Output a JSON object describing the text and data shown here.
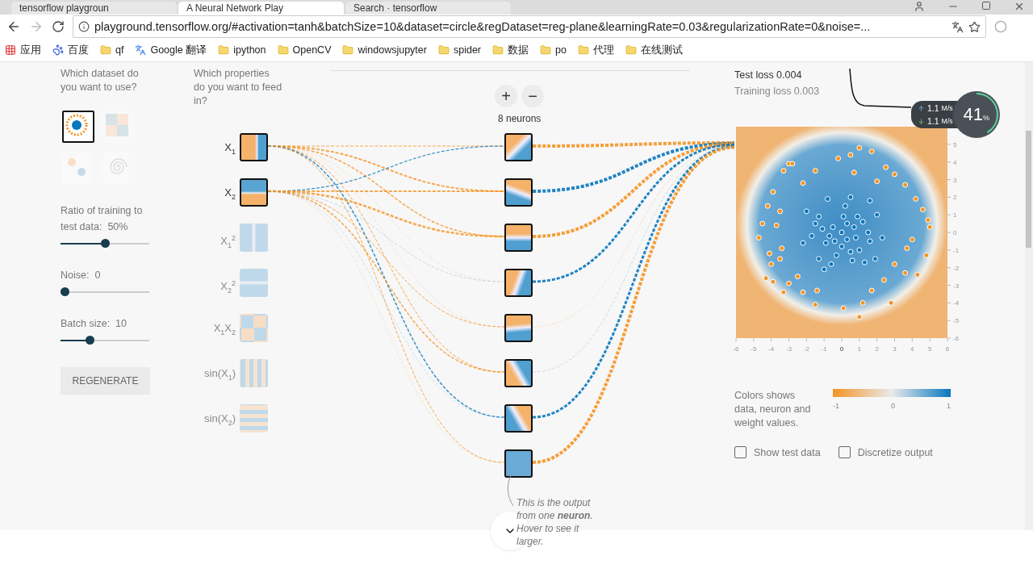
{
  "browser": {
    "tabs": [
      {
        "label": "tensorflow playgroun",
        "selected": false
      },
      {
        "label": "A Neural Network Play",
        "selected": true
      },
      {
        "label": "Search · tensorflow",
        "selected": false
      }
    ],
    "url": "playground.tensorflow.org/#activation=tanh&batchSize=10&dataset=circle&regDataset=reg-plane&learningRate=0.03&regularizationRate=0&noise=...",
    "bookmarks": [
      {
        "label": "应用",
        "kind": "apps"
      },
      {
        "label": "百度",
        "kind": "paw"
      },
      {
        "label": "qf",
        "kind": "folder"
      },
      {
        "label": "Google 翻译",
        "kind": "translate"
      },
      {
        "label": "ipython",
        "kind": "folder"
      },
      {
        "label": "OpenCV",
        "kind": "folder"
      },
      {
        "label": "windowsjupyter",
        "kind": "folder"
      },
      {
        "label": "spider",
        "kind": "folder"
      },
      {
        "label": "数据",
        "kind": "folder"
      },
      {
        "label": "po",
        "kind": "folder"
      },
      {
        "label": "代理",
        "kind": "folder"
      },
      {
        "label": "在线测试",
        "kind": "folder"
      }
    ]
  },
  "data_panel": {
    "heading": "Which dataset do you want to use?",
    "datasets": [
      {
        "kind": "circle",
        "selected": true
      },
      {
        "kind": "xor",
        "selected": false
      },
      {
        "kind": "gauss",
        "selected": false
      },
      {
        "kind": "spiral",
        "selected": false
      }
    ],
    "sliders": [
      {
        "label": "Ratio of training to test data:",
        "reading": "50%",
        "level": 0.5
      },
      {
        "label": "Noise:",
        "reading": "0",
        "level": 0
      },
      {
        "label": "Batch size:",
        "reading": "10",
        "level": 0.31
      }
    ],
    "regenerate": "REGENERATE"
  },
  "features": {
    "heading": "Which properties do you want to feed in?",
    "items": [
      {
        "label": "X$_{1}$",
        "kind": "x1",
        "on": true
      },
      {
        "label": "X$_{2}$",
        "kind": "x2",
        "on": true
      },
      {
        "label": "X$_{1}$$^{2}$",
        "kind": "x1sq",
        "on": false
      },
      {
        "label": "X$_{2}$$^{2}$",
        "kind": "x2sq",
        "on": false
      },
      {
        "label": "X$_{1}$X$_{2}$",
        "kind": "x1x2",
        "on": false
      },
      {
        "label": "sin(X$_{1}$)",
        "kind": "sin1",
        "on": false
      },
      {
        "label": "sin(X$_{2}$)",
        "kind": "sin2",
        "on": false
      }
    ]
  },
  "hidden_layer": {
    "add": "+",
    "remove": "−",
    "count": "8 neurons"
  },
  "tooltip": "This is the output from one **neuron**. Hover to see it larger.",
  "output": {
    "test_loss": "Test loss 0.004",
    "training_loss": "Training loss 0.003",
    "chart_data": {
      "type": "scatter",
      "xlim": [
        -6,
        6
      ],
      "ylim": [
        -6,
        6
      ],
      "xticks": [
        {
          "value": -6,
          "label": "-6"
        },
        {
          "value": -5,
          "label": "-5"
        },
        {
          "value": -4,
          "label": "-4"
        },
        {
          "value": -3,
          "label": "-3"
        },
        {
          "value": -2,
          "label": "-2"
        },
        {
          "value": -1,
          "label": "-1"
        },
        {
          "value": 0,
          "label": "0"
        },
        {
          "value": 1,
          "label": "1"
        },
        {
          "value": 2,
          "label": "2"
        },
        {
          "value": 3,
          "label": "3"
        },
        {
          "value": 4,
          "label": "4"
        },
        {
          "value": 5,
          "label": "5"
        },
        {
          "value": 6,
          "label": "6"
        }
      ],
      "yticks": [
        {
          "value": -6,
          "label": "-6"
        },
        {
          "value": -5,
          "label": "-5"
        },
        {
          "value": -4,
          "label": "-4"
        },
        {
          "value": -3,
          "label": "-3"
        },
        {
          "value": -2,
          "label": "-2"
        },
        {
          "value": -1,
          "label": "-1"
        },
        {
          "value": 0,
          "label": "0"
        },
        {
          "value": 1,
          "label": "1"
        },
        {
          "value": 2,
          "label": "2"
        },
        {
          "value": 3,
          "label": "3"
        },
        {
          "value": 4,
          "label": "4"
        },
        {
          "value": 5,
          "label": "5"
        }
      ],
      "series": [
        {
          "color": "#0877bd",
          "x": [
            0,
            0.3,
            -0.5,
            0.8,
            -0.9,
            1.2,
            -1.3,
            0.5,
            -0.3,
            1.6,
            -1.7,
            0.2,
            -0.8,
            0.5,
            1.6,
            2,
            -2,
            -2.2,
            2.3,
            1.3,
            -0.6,
            0.6,
            -1,
            1.9,
            -1.3,
            0.1,
            0.9,
            -0.4,
            1.5,
            -1.5,
            0,
            0.7,
            -0.7,
            1,
            -1.1,
            0.3
          ],
          "values": [
            0,
            0.5,
            0.3,
            -0.3,
            -0.6,
            0.6,
            0.9,
            -1.1,
            -1.3,
            -0.5,
            -0.2,
            1.5,
            1.9,
            2,
            1.8,
            1,
            1.2,
            -0.6,
            -0.3,
            -1.7,
            -1.8,
            -1.6,
            -2.1,
            -1.5,
            -1.5,
            0.9,
            0.9,
            -0.5,
            0,
            0.5,
            -0.8,
            0.3,
            -0.2,
            -1,
            0.2,
            -0.4
          ]
        },
        {
          "color": "#f59322",
          "x": [
            -4.5,
            -4.2,
            -3.9,
            -3,
            -2.2,
            -1.5,
            -0.2,
            0.5,
            1,
            1.7,
            2.5,
            3,
            3.6,
            4.2,
            4.6,
            4.9,
            5,
            4,
            3.7,
            4.8,
            4.3,
            3.6,
            3,
            2.4,
            2.8,
            1.7,
            1.2,
            1,
            0.1,
            -1.4,
            -1.5,
            -2.2,
            -2.5,
            -3,
            -3.3,
            -3.9,
            -4.3,
            -4,
            -3.5,
            -4.1,
            -3.4,
            -4.7,
            -3.7,
            -3.5,
            -3.3,
            -2.8,
            0.7,
            2
          ],
          "values": [
            0.5,
            1.5,
            2.3,
            3.9,
            2.8,
            3.5,
            4.2,
            4.4,
            4.8,
            4.6,
            3.7,
            3.3,
            2.7,
            1.9,
            1.3,
            0.7,
            0.3,
            -0.4,
            -0.9,
            -1.3,
            -2.4,
            -2.3,
            -1.8,
            -2.7,
            -4,
            -3.3,
            -4,
            -4.8,
            -4.3,
            -3.3,
            -4.1,
            -3.4,
            -2.5,
            -2.9,
            -3.4,
            -2.8,
            -2.6,
            -1.8,
            -1.5,
            -1.2,
            -0.9,
            -0.3,
            0.4,
            1.2,
            3.5,
            3.9,
            3.4,
            2.9
          ]
        }
      ]
    },
    "legend": {
      "text": "Colors shows data, neuron and weight values.",
      "ticks": [
        "-1",
        "0",
        "1"
      ]
    },
    "checkboxes": [
      {
        "label": "Show test data",
        "checked": false
      },
      {
        "label": "Discretize output",
        "checked": false
      }
    ]
  },
  "net_monitor": {
    "upload": "1.1",
    "upload_unit": "M/s",
    "download": "1.1",
    "download_unit": "M/s",
    "percent": "41",
    "percent_sign": "%"
  }
}
